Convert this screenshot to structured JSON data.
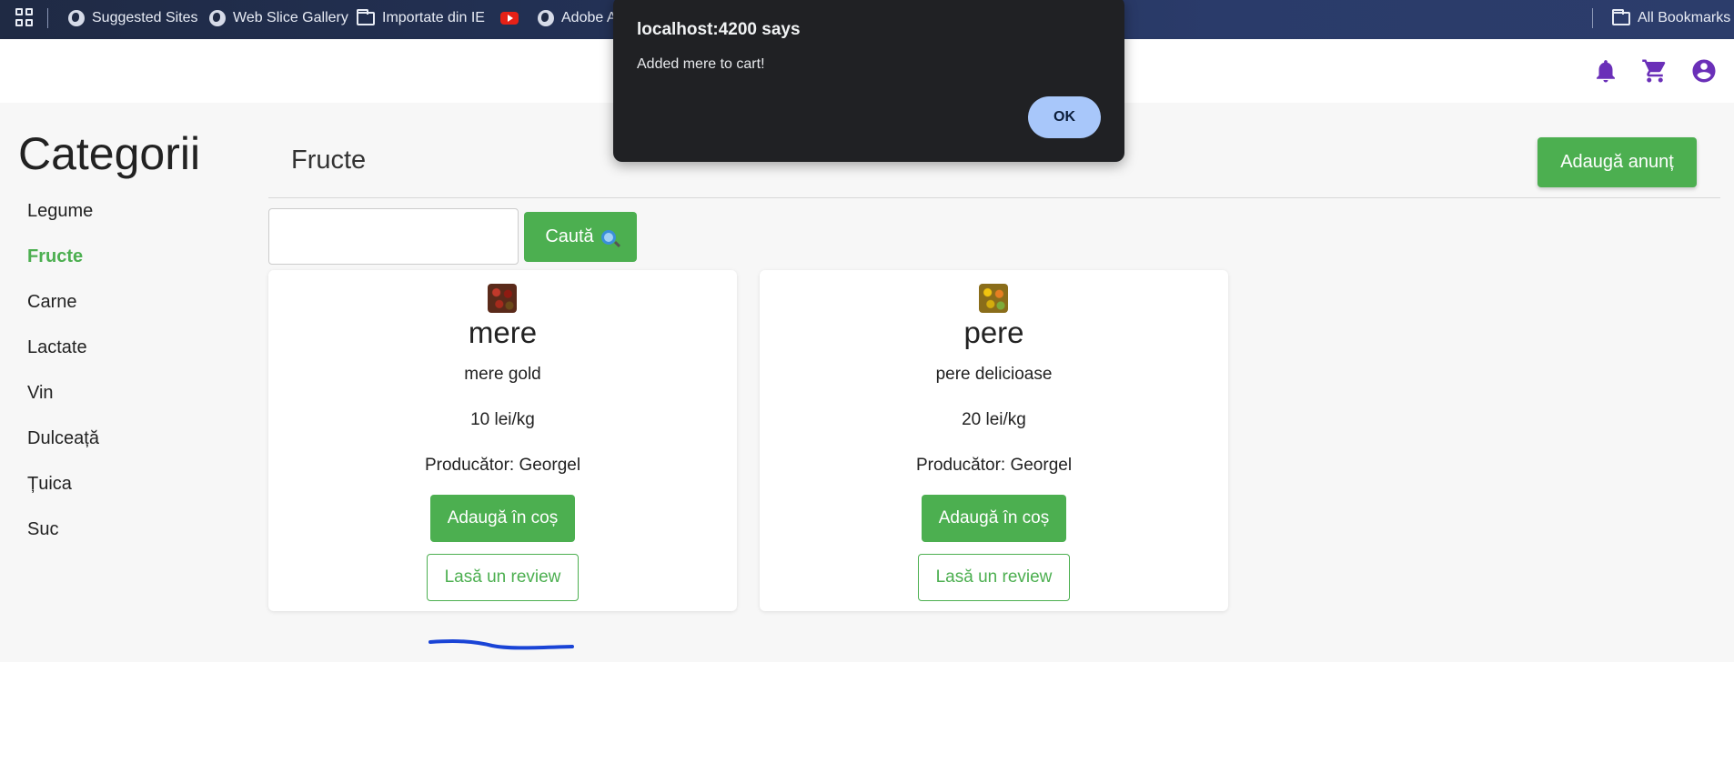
{
  "bookmarks": {
    "items": [
      {
        "label": "Suggested Sites",
        "icon": "globe-icon"
      },
      {
        "label": "Web Slice Gallery",
        "icon": "globe-icon"
      },
      {
        "label": "Importate din IE",
        "icon": "folder-icon"
      },
      {
        "label": "",
        "icon": "youtube-icon"
      },
      {
        "label": "Adobe A",
        "icon": "globe-icon"
      }
    ],
    "all_bookmarks": "All Bookmarks"
  },
  "header": {
    "icons": [
      "bell-icon",
      "cart-icon",
      "account-icon"
    ],
    "accent_color": "#6a2fb8"
  },
  "sidebar": {
    "title": "Categorii",
    "items": [
      "Legume",
      "Fructe",
      "Carne",
      "Lactate",
      "Vin",
      "Dulceață",
      "Țuica",
      "Suc"
    ],
    "active": "Fructe"
  },
  "content": {
    "title": "Fructe",
    "add_button": "Adaugă anunț",
    "search_value": "",
    "search_button": "Caută"
  },
  "products": [
    {
      "name": "mere",
      "description": "mere gold",
      "price": "10 lei/kg",
      "producer": "Producător: Georgel",
      "add_button": "Adaugă în coș",
      "review_button": "Lasă un review"
    },
    {
      "name": "pere",
      "description": "pere delicioase",
      "price": "20 lei/kg",
      "producer": "Producător: Georgel",
      "add_button": "Adaugă în coș",
      "review_button": "Lasă un review"
    }
  ],
  "dialog": {
    "title": "localhost:4200 says",
    "message": "Added mere to cart!",
    "ok": "OK"
  },
  "colors": {
    "primary_green": "#4caf50",
    "dialog_bg": "#202124",
    "ok_button": "#a8c7fa"
  }
}
